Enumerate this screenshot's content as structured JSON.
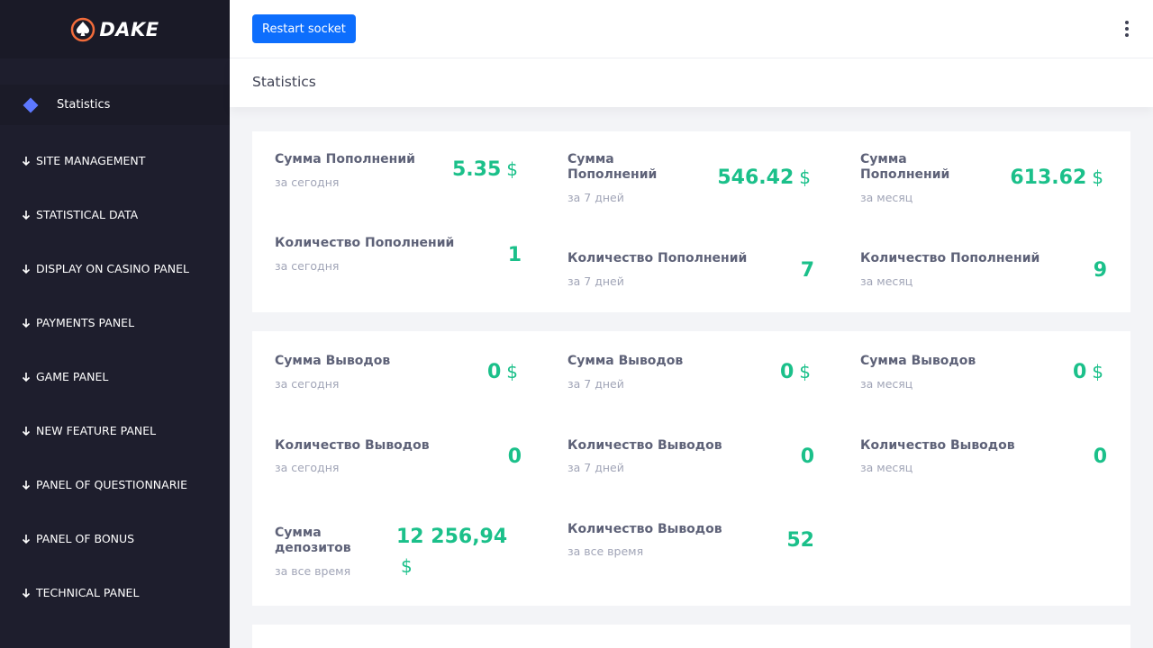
{
  "brand": {
    "name": "DAKE"
  },
  "sidebar": {
    "active_item": "Statistics",
    "sections": [
      "SITE MANAGEMENT",
      "STATISTICAL DATA",
      "DISPLAY ON CASINO PANEL",
      "PAYMENTS PANEL",
      "GAME PANEL",
      "NEW FEATURE PANEL",
      "PANEL OF QUESTIONNARIE",
      "PANEL OF BONUS",
      "TECHNICAL PANEL"
    ]
  },
  "header": {
    "restart_button": "Restart socket",
    "menu_icon": "kebab-menu-icon"
  },
  "page": {
    "title": "Statistics"
  },
  "currency_symbol": "$",
  "colors": {
    "accent": "#1bc08a",
    "primary_button": "#0d6efd",
    "sidebar_bg": "#1e1e2d",
    "active_diamond": "#5d78ff"
  },
  "deposits": {
    "sum_today": {
      "label": "Сумма Пополнений",
      "sub": "за сегодня",
      "value": "5.35"
    },
    "sum_week": {
      "label_line1": "Сумма",
      "label_line2": "Пополнений",
      "sub": "за 7 дней",
      "value": "546.42"
    },
    "sum_month": {
      "label_line1": "Сумма",
      "label_line2": "Пополнений",
      "sub": "за месяц",
      "value": "613.62"
    },
    "count_today": {
      "label": "Количество Пополнений",
      "sub": "за сегодня",
      "value": "1"
    },
    "count_week": {
      "label": "Количество Пополнений",
      "sub": "за 7 дней",
      "value": "7"
    },
    "count_month": {
      "label": "Количество Пополнений",
      "sub": "за месяц",
      "value": "9"
    }
  },
  "withdrawals": {
    "sum_today": {
      "label": "Сумма Выводов",
      "sub": "за сегодня",
      "value": "0"
    },
    "sum_week": {
      "label": "Сумма Выводов",
      "sub": "за 7 дней",
      "value": "0"
    },
    "sum_month": {
      "label": "Сумма Выводов",
      "sub": "за месяц",
      "value": "0"
    },
    "count_today": {
      "label": "Количество Выводов",
      "sub": "за сегодня",
      "value": "0"
    },
    "count_week": {
      "label": "Количество Выводов",
      "sub": "за 7 дней",
      "value": "0"
    },
    "count_month": {
      "label": "Количество Выводов",
      "sub": "за месяц",
      "value": "0"
    },
    "deposits_all_time": {
      "label_line1": "Сумма",
      "label_line2": "депозитов",
      "sub": "за все время",
      "value": "12 256,94"
    },
    "count_all_time": {
      "label": "Количество Выводов",
      "sub": "за все время",
      "value": "52"
    }
  }
}
